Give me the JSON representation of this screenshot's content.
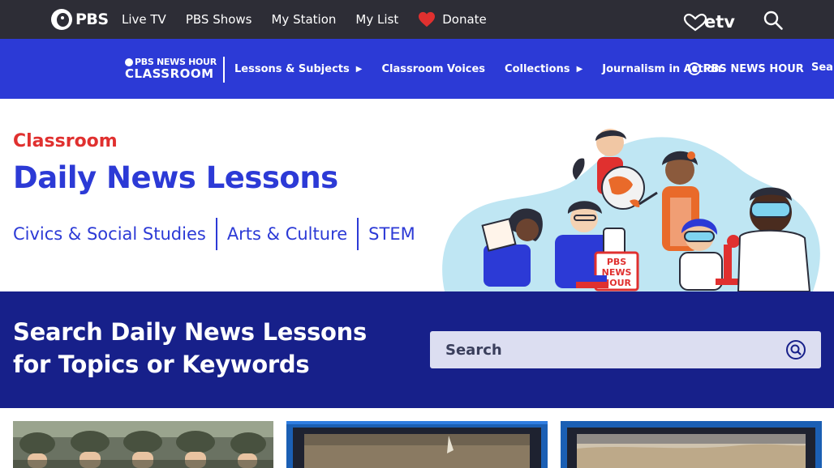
{
  "topbar": {
    "brand": "PBS",
    "nav": [
      "Live TV",
      "PBS Shows",
      "My Station",
      "My List"
    ],
    "donate_label": "Donate",
    "station_logo": "etv",
    "icons": {
      "heart": "heart-icon",
      "search": "search-icon"
    }
  },
  "subbar": {
    "logo_line1": "PBS NEWS HOUR",
    "logo_line2": "CLASSROOM",
    "nav": [
      {
        "label": "Lessons & Subjects",
        "has_menu": true
      },
      {
        "label": "Classroom Voices",
        "has_menu": false
      },
      {
        "label": "Collections",
        "has_menu": true
      },
      {
        "label": "Journalism in Action",
        "has_menu": false
      }
    ],
    "menu_glyph": "▶",
    "partner_logo": "PBS NEWS HOUR",
    "search_label": "Search"
  },
  "hero": {
    "eyebrow": "Classroom",
    "title": "Daily News Lessons",
    "categories": [
      "Civics & Social Studies",
      "Arts & Culture",
      "STEM"
    ],
    "illustration_sign_l1": "PBS",
    "illustration_sign_l2": "NEWS",
    "illustration_sign_l3": "HOUR"
  },
  "search": {
    "heading": "Search Daily News Lessons for Topics or Keywords",
    "placeholder": "Search"
  },
  "colors": {
    "top_bar": "#2d2d36",
    "brand_blue": "#2c3ad6",
    "search_band": "#17208a",
    "accent_red": "#e0302f",
    "search_field": "#dcdef1"
  }
}
